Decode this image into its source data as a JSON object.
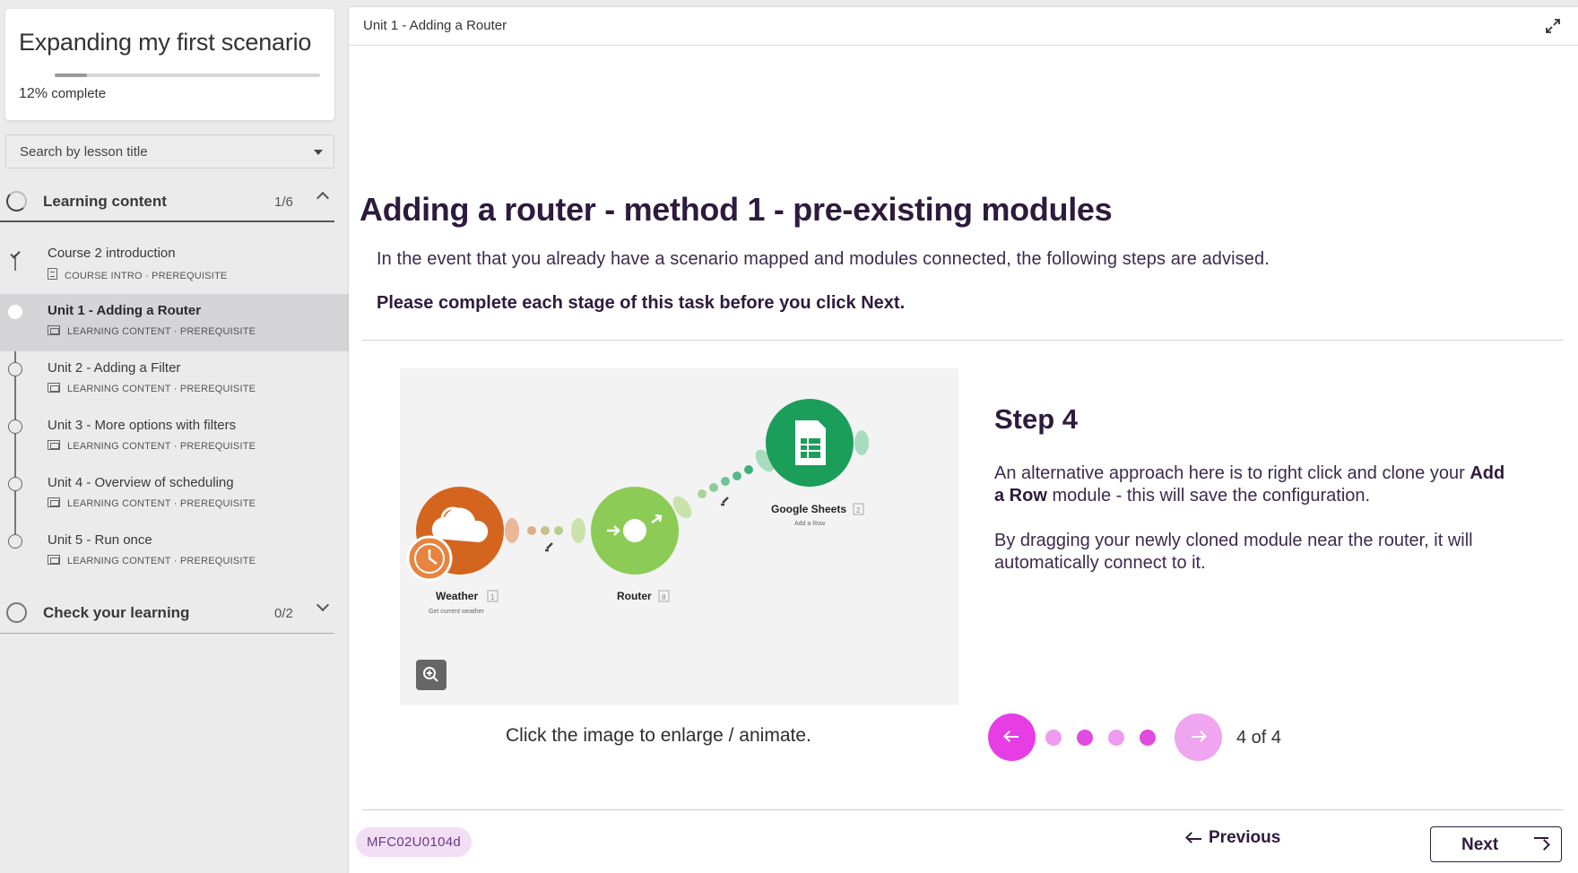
{
  "sidebar": {
    "course_title": "Expanding my first scenario",
    "progress": {
      "percent": 12,
      "percent_label": "12%",
      "suffix": "complete"
    },
    "search": {
      "placeholder": "Search by lesson title"
    },
    "sections": [
      {
        "label": "Learning content",
        "count": "1/6",
        "expanded": true
      },
      {
        "label": "Check your learning",
        "count": "0/2",
        "expanded": false
      }
    ],
    "lessons": [
      {
        "title": "Course 2 introduction",
        "type": "COURSE INTRO",
        "tag": "PREREQUISITE",
        "status": "complete",
        "icon": "document-icon"
      },
      {
        "title": "Unit 1 - Adding a Router",
        "type": "LEARNING CONTENT",
        "tag": "PREREQUISITE",
        "status": "active",
        "icon": "slides-icon"
      },
      {
        "title": "Unit 2 - Adding a Filter",
        "type": "LEARNING CONTENT",
        "tag": "PREREQUISITE",
        "status": "not-started",
        "icon": "slides-icon"
      },
      {
        "title": "Unit 3 - More options with filters",
        "type": "LEARNING CONTENT",
        "tag": "PREREQUISITE",
        "status": "not-started",
        "icon": "slides-icon"
      },
      {
        "title": "Unit 4 - Overview of scheduling",
        "type": "LEARNING CONTENT",
        "tag": "PREREQUISITE",
        "status": "not-started",
        "icon": "slides-icon"
      },
      {
        "title": "Unit 5 - Run once",
        "type": "LEARNING CONTENT",
        "tag": "PREREQUISITE",
        "status": "not-started",
        "icon": "slides-icon"
      }
    ],
    "meta_separator": "·"
  },
  "main": {
    "breadcrumb": "Unit 1 - Adding a Router",
    "heading": "Adding a router - method 1 - pre-existing modules",
    "intro": "In the event that you already have a scenario mapped and modules connected, the following steps are advised.",
    "instruction": "Please complete each stage of this task before you click Next.",
    "figure": {
      "caption": "Click the image to enlarge / animate.",
      "modules": [
        {
          "name": "Weather",
          "number": "1",
          "sub": "Get current weather",
          "color": "#d4651f"
        },
        {
          "name": "Router",
          "number": "8",
          "sub": "",
          "color": "#8ccc56"
        },
        {
          "name": "Google Sheets",
          "number": "2",
          "sub": "Add a Row",
          "color": "#1b9e5a"
        }
      ]
    },
    "step": {
      "title": "Step 4",
      "p1_before": "An alternative approach here is to right click and clone your",
      "p1_bold": "Add a Row",
      "p1_after": "module - this will save the configuration.",
      "p2": "By dragging your newly cloned module near the router, it will automatically connect to it."
    },
    "carousel": {
      "current": 4,
      "total": 4,
      "label": "4 of 4"
    },
    "footer": {
      "code": "MFC02U0104d",
      "previous_label": "Previous",
      "next_label": "Next"
    }
  },
  "colors": {
    "accent_magenta": "#e63ee4",
    "accent_light": "#efa5ef",
    "heading_purple": "#2d1b3e",
    "badge_bg": "#f2def5"
  }
}
